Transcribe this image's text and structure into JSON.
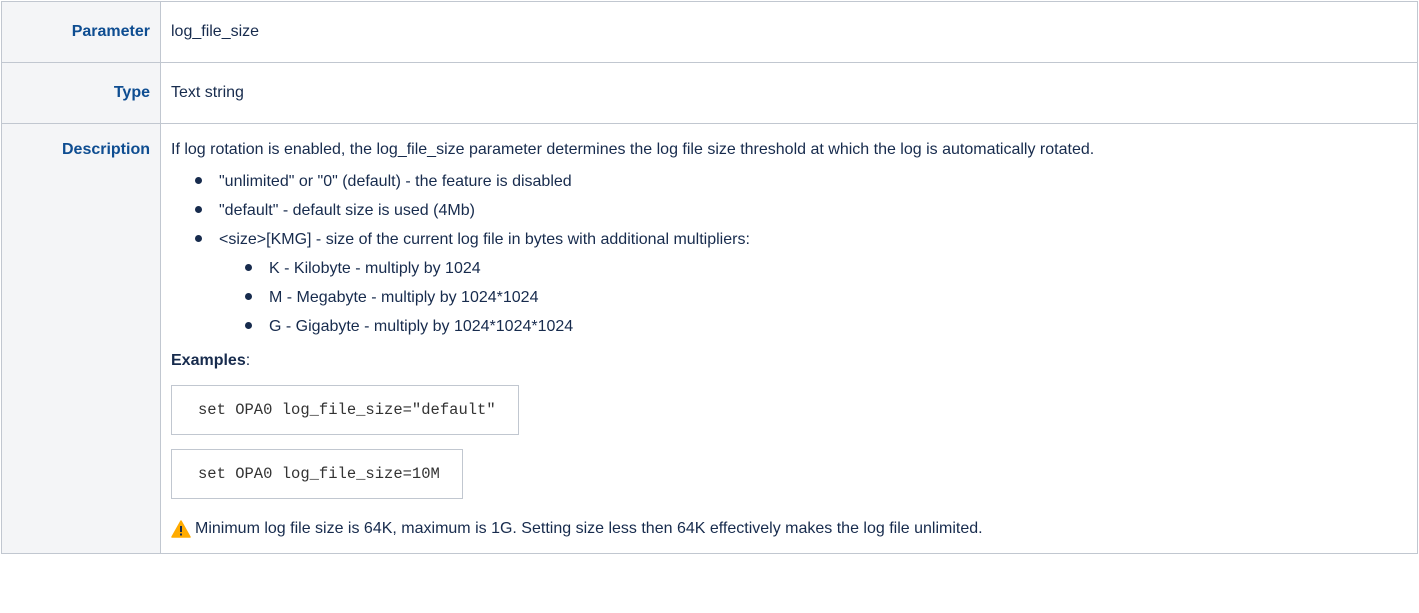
{
  "table": {
    "parameter": {
      "label": "Parameter",
      "value": "log_file_size"
    },
    "type": {
      "label": "Type",
      "value": "Text string"
    },
    "description": {
      "label": "Description",
      "intro": "If log rotation is enabled, the log_file_size parameter determines the log file size threshold at which the log is automatically rotated.",
      "bullets": [
        "\"unlimited\" or \"0\" (default) - the feature is disabled",
        "\"default\" - default size is used (4Mb)",
        "<size>[KMG] - size of the current log file in bytes with additional multipliers:"
      ],
      "sub_bullets": [
        "K - Kilobyte - multiply by 1024",
        "M - Megabyte - multiply by 1024*1024",
        "G - Gigabyte - multiply by 1024*1024*1024"
      ],
      "examples_label": "Examples",
      "examples_colon": ":",
      "code_examples": [
        "set OPA0 log_file_size=\"default\"",
        "set OPA0 log_file_size=10M"
      ],
      "note_icon": "warning-icon",
      "note_icon_color": "#ffab00",
      "note": "Minimum log file size is 64K, maximum is 1G. Setting size less then 64K effectively makes the log file unlimited."
    }
  },
  "colors": {
    "header_bg": "#f4f5f7",
    "header_text": "#0e4d91",
    "border": "#c1c7d0",
    "body_text": "#172b4d"
  }
}
